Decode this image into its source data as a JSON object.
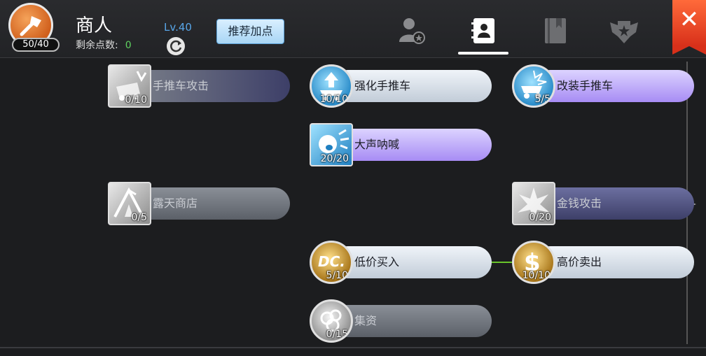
{
  "header": {
    "char_badge": "50/40",
    "class_name": "商人",
    "remain_label": "剩余点数:",
    "remain_value": "0",
    "level": "Lv.40",
    "recommend_label": "推荐加点",
    "active_tab_index": 1
  },
  "skills": [
    {
      "id": "cart-attack",
      "name": "手推车攻击",
      "count": "0/10",
      "style": "grey-navy",
      "icon": "cart-attack-icon"
    },
    {
      "id": "enhance-cart",
      "name": "强化手推车",
      "count": "10/10",
      "style": "white",
      "icon": "cart-upgrade-icon"
    },
    {
      "id": "modify-cart",
      "name": "改装手推车",
      "count": "5/5",
      "style": "lilac",
      "icon": "cart-modify-icon"
    },
    {
      "id": "loud-shout",
      "name": "大声呐喊",
      "count": "20/20",
      "style": "lilac",
      "icon": "shout-icon"
    },
    {
      "id": "open-shop",
      "name": "露天商店",
      "count": "0/5",
      "style": "grey",
      "icon": "tent-icon"
    },
    {
      "id": "money-attack",
      "name": "金钱攻击",
      "count": "0/20",
      "style": "navy",
      "icon": "money-attack-icon"
    },
    {
      "id": "buy-low",
      "name": "低价买入",
      "count": "5/10",
      "style": "white",
      "icon": "dc-icon"
    },
    {
      "id": "sell-high",
      "name": "高价卖出",
      "count": "10/10",
      "style": "white",
      "icon": "dollar-icon"
    },
    {
      "id": "gather-funds",
      "name": "集资",
      "count": "0/15",
      "style": "grey",
      "icon": "coins-icon"
    }
  ],
  "colors": {
    "accent": "#58a6e8",
    "points": "#5fd160",
    "close": "#e8411f",
    "link": "#69c52a"
  }
}
